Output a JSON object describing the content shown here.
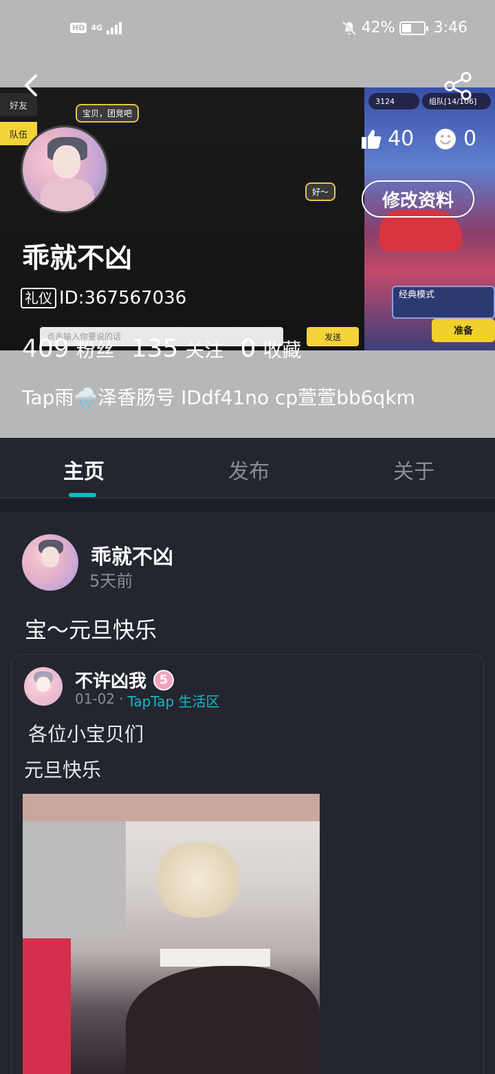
{
  "status_bar": {
    "network": "HD",
    "network_gen": "4G",
    "battery": "42%",
    "time": "3:46"
  },
  "cover": {
    "chat_tabs": [
      "好友",
      "队伍"
    ],
    "chat_messages": [
      "宝贝，团竞吧",
      "好～"
    ],
    "input_placeholder": "点击输入你要说的话",
    "send_label": "发送",
    "game_coins": "3124",
    "game_team": "组队[14/106]",
    "game_mode": "经典模式",
    "game_ready": "准备"
  },
  "profile": {
    "likes": "40",
    "emoji_count": "0",
    "edit_label": "修改资料",
    "username": "乖就不凶",
    "badge": "礼仪",
    "id_text": "ID:367567036",
    "stats": [
      {
        "num": "409",
        "label": "粉丝"
      },
      {
        "num": "135",
        "label": "关注"
      },
      {
        "num": "0",
        "label": "收藏"
      }
    ],
    "bio": "Tap雨🌧️泽香肠号 IDdf41no cp萱萱bb6qkm"
  },
  "tabs": {
    "items": [
      "主页",
      "发布",
      "关于"
    ],
    "active": "主页"
  },
  "post": {
    "author": "乖就不凶",
    "time": "5天前",
    "text": "宝～元旦快乐",
    "repost": {
      "author": "不许凶我",
      "level": "5",
      "date": "01-02",
      "separator": "·",
      "source": "TapTap 生活区",
      "line1": "各位小宝贝们",
      "line2": "元旦快乐"
    }
  },
  "colors": {
    "accent": "#14b9c8",
    "background": "#23252f",
    "cover_bg": "#b7b7b9"
  }
}
